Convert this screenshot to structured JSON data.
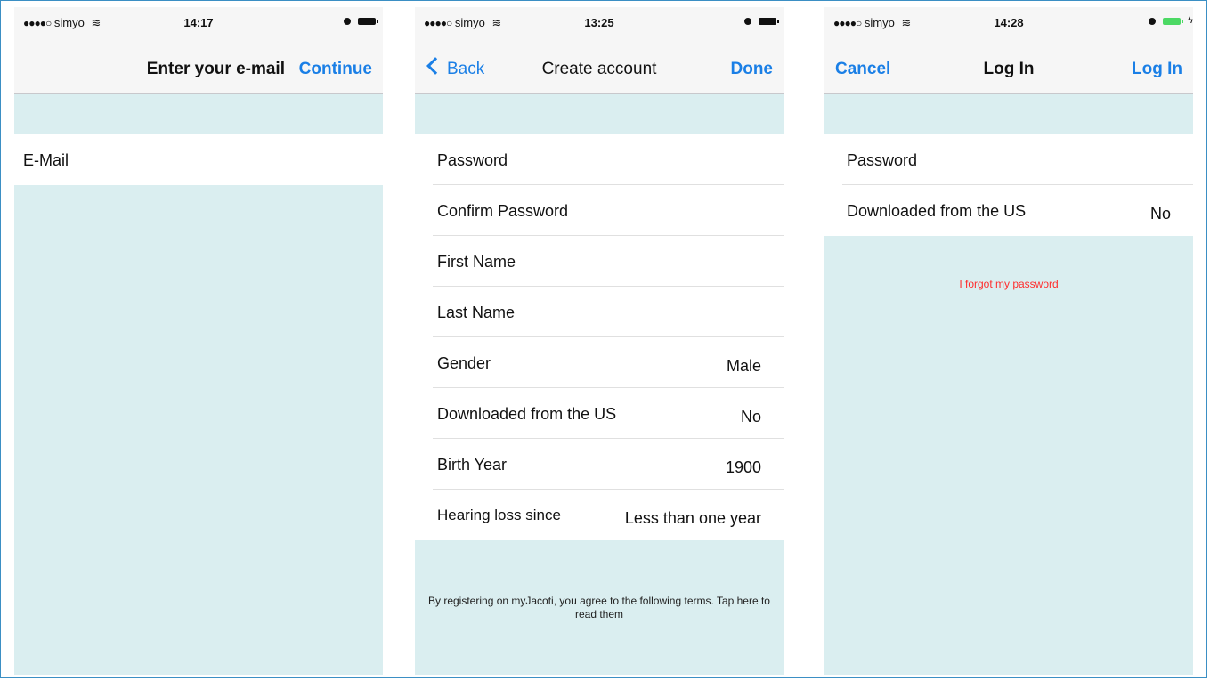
{
  "screens": [
    {
      "status": {
        "carrier": "simyo",
        "time": "14:17"
      },
      "nav": {
        "title": "Enter your e-mail",
        "right": "Continue"
      },
      "cells": [
        {
          "label": "E-Mail",
          "value": ""
        }
      ]
    },
    {
      "status": {
        "carrier": "simyo",
        "time": "13:25"
      },
      "nav": {
        "left": "Back",
        "title": "Create account",
        "right": "Done"
      },
      "cells": [
        {
          "label": "Password",
          "value": ""
        },
        {
          "label": "Confirm Password",
          "value": ""
        },
        {
          "label": "First Name",
          "value": ""
        },
        {
          "label": "Last Name",
          "value": ""
        },
        {
          "label": "Gender",
          "value": "Male"
        },
        {
          "label": "Downloaded from the US",
          "value": "No"
        },
        {
          "label": "Birth Year",
          "value": "1900"
        },
        {
          "label": "Hearing loss since",
          "value": "Less than one year"
        }
      ],
      "footer": "By registering on myJacoti, you agree to the following terms. Tap here to read them"
    },
    {
      "status": {
        "carrier": "simyo",
        "time": "14:28"
      },
      "nav": {
        "left": "Cancel",
        "title": "Log In",
        "right": "Log In"
      },
      "cells": [
        {
          "label": "Password",
          "value": ""
        },
        {
          "label": "Downloaded from the US",
          "value": "No"
        }
      ],
      "link": "I forgot my password"
    }
  ],
  "colors": {
    "accent": "#1a7fe6",
    "background": "#daeef0",
    "link_red": "#ff2d2d",
    "battery_green": "#4cd964"
  }
}
